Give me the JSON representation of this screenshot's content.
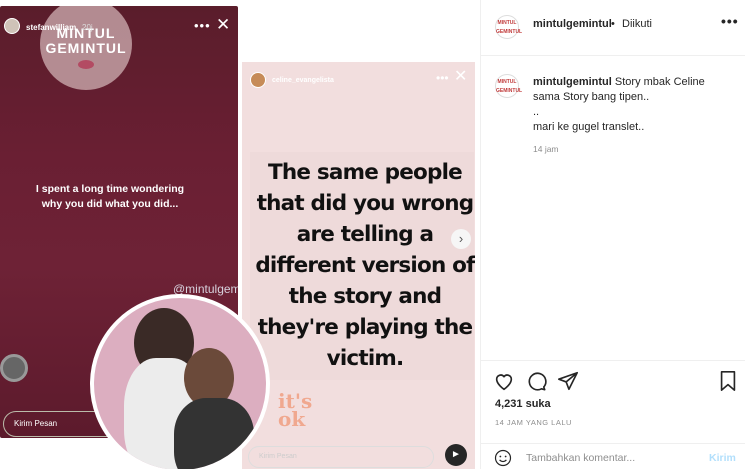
{
  "story_left": {
    "username": "stefanwilliam",
    "time": "20j",
    "logo_text": "MINTUL\nGEMINTUL",
    "quote": "I spent a long time wondering why you did what you did...",
    "watermark": "@mintulgemintul",
    "message_placeholder": "Kirim Pesan"
  },
  "story_right": {
    "username": "celine_evangelista",
    "quote": "The same people that did you wrong are telling a different version of the story and they're playing the victim.",
    "sticker": "it's ok",
    "message_placeholder": "Kirim Pesan"
  },
  "post_header": {
    "username": "mintulgemintul",
    "separator": "•",
    "follow_status": "Diikuti",
    "avatar_text": "MINTUL GEMINTUL"
  },
  "caption": {
    "username": "mintulgemintul",
    "line1": "Story mbak Celine sama Story bang tipen..",
    "line2": "..",
    "line3": "mari ke gugel translet..",
    "time": "14 jam"
  },
  "actions": {
    "likes": "4,231 suka",
    "time_ago": "14 JAM YANG LALU",
    "comment_placeholder": "Tambahkan komentar...",
    "send_label": "Kirim"
  },
  "colors": {
    "story_left_bg": "#5e1c2d",
    "story_right_bg": "#f2dede",
    "link_blue_disabled": "#b2dffc"
  },
  "icons": [
    "close-icon",
    "more-icon",
    "heart-icon",
    "comment-icon",
    "share-icon",
    "bookmark-icon",
    "emoji-icon",
    "sound-icon",
    "chevron-right-icon"
  ]
}
